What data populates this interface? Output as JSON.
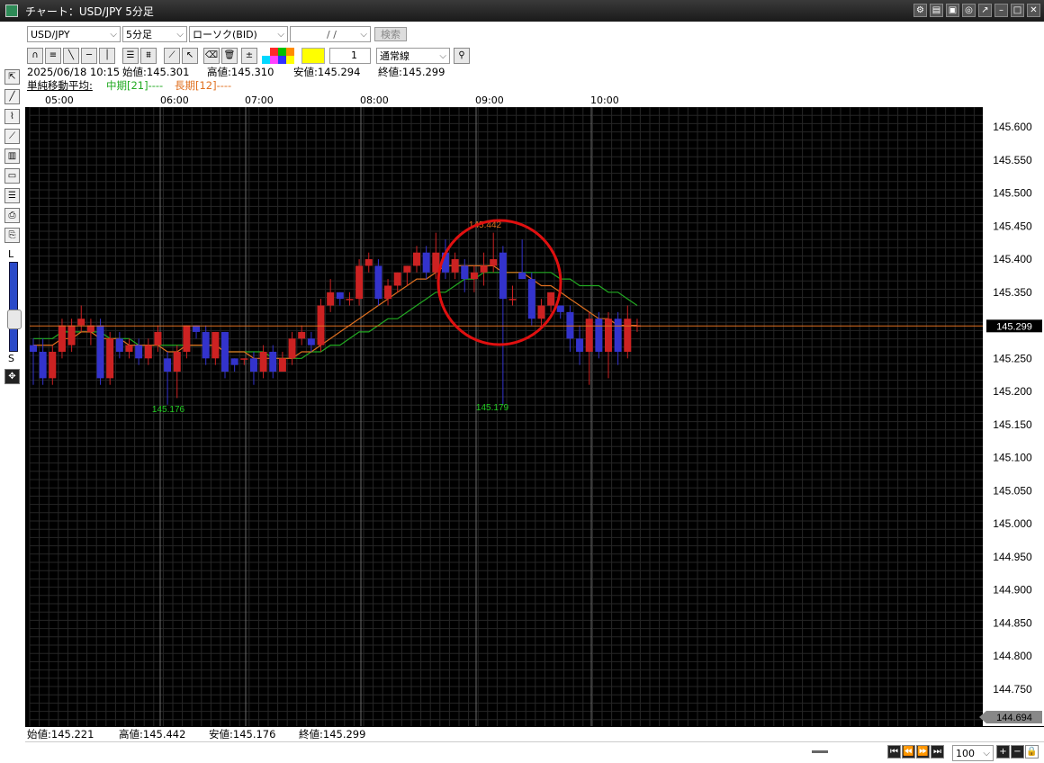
{
  "window": {
    "title": "チャート：USD/JPY 5分足"
  },
  "toolbar": {
    "symbol": "USD/JPY",
    "timeframe": "5分足",
    "chart_type": "ローソク(BID)",
    "date": "/ /",
    "search_label": "検索",
    "line_count": "1",
    "line_style": "通常線"
  },
  "ohlc_current": {
    "datetime": "2025/06/18 10:15",
    "open": "始値:145.301",
    "high": "高値:145.310",
    "low": "安値:145.294",
    "close": "終値:145.299"
  },
  "indicator": {
    "name": "単純移動平均:",
    "mid": "中期[21]----",
    "long": "長期[12]----"
  },
  "time_labels": [
    "05:00",
    "06:00",
    "07:00",
    "08:00",
    "09:00",
    "10:00"
  ],
  "price_labels": [
    "145.600",
    "145.550",
    "145.500",
    "145.450",
    "145.400",
    "145.350",
    "145.300",
    "145.250",
    "145.200",
    "145.150",
    "145.100",
    "145.050",
    "145.000",
    "144.950",
    "144.900",
    "144.850",
    "144.800",
    "144.750"
  ],
  "current_price": "145.299",
  "bottom_price": "144.694",
  "annotations": {
    "high_label": "145.442",
    "low_label_1": "145.176",
    "low_label_2": "145.179"
  },
  "summary": {
    "open": "始値:145.221",
    "high": "高値:145.442",
    "low": "安値:145.176",
    "close": "終値:145.299"
  },
  "status": {
    "zoom": "100"
  },
  "sidebar": {
    "l_label": "L",
    "s_label": "S"
  },
  "colors": {
    "bull": "#cc2222",
    "bear": "#3333cc",
    "ma_mid": "#22aa22",
    "ma_long": "#e07020",
    "circle": "#e01010"
  },
  "chart_data": {
    "type": "candlestick",
    "ylim": [
      144.694,
      145.63
    ],
    "candles": [
      [
        145.27,
        145.26,
        145.28,
        145.21
      ],
      [
        145.26,
        145.22,
        145.28,
        145.21
      ],
      [
        145.22,
        145.26,
        145.27,
        145.21
      ],
      [
        145.26,
        145.3,
        145.31,
        145.25
      ],
      [
        145.27,
        145.3,
        145.31,
        145.26
      ],
      [
        145.3,
        145.31,
        145.33,
        145.29
      ],
      [
        145.29,
        145.3,
        145.31,
        145.27
      ],
      [
        145.3,
        145.22,
        145.31,
        145.21
      ],
      [
        145.22,
        145.28,
        145.29,
        145.21
      ],
      [
        145.28,
        145.26,
        145.29,
        145.25
      ],
      [
        145.26,
        145.27,
        145.28,
        145.25
      ],
      [
        145.27,
        145.25,
        145.28,
        145.24
      ],
      [
        145.25,
        145.27,
        145.28,
        145.24
      ],
      [
        145.27,
        145.29,
        145.3,
        145.26
      ],
      [
        145.25,
        145.23,
        145.26,
        145.18
      ],
      [
        145.23,
        145.26,
        145.27,
        145.19
      ],
      [
        145.26,
        145.3,
        145.3,
        145.25
      ],
      [
        145.3,
        145.29,
        145.3,
        145.28
      ],
      [
        145.29,
        145.25,
        145.3,
        145.24
      ],
      [
        145.25,
        145.29,
        145.29,
        145.24
      ],
      [
        145.29,
        145.23,
        145.29,
        145.22
      ],
      [
        145.25,
        145.24,
        145.25,
        145.23
      ],
      [
        145.25,
        145.25,
        145.25,
        145.24
      ],
      [
        145.25,
        145.23,
        145.26,
        145.21
      ],
      [
        145.23,
        145.26,
        145.27,
        145.22
      ],
      [
        145.26,
        145.23,
        145.27,
        145.22
      ],
      [
        145.23,
        145.25,
        145.26,
        145.23
      ],
      [
        145.25,
        145.28,
        145.29,
        145.24
      ],
      [
        145.28,
        145.29,
        145.3,
        145.27
      ],
      [
        145.28,
        145.27,
        145.29,
        145.26
      ],
      [
        145.27,
        145.33,
        145.34,
        145.26
      ],
      [
        145.33,
        145.35,
        145.37,
        145.32
      ],
      [
        145.35,
        145.34,
        145.35,
        145.33
      ],
      [
        145.34,
        145.34,
        145.35,
        145.33
      ],
      [
        145.34,
        145.39,
        145.4,
        145.33
      ],
      [
        145.39,
        145.4,
        145.41,
        145.38
      ],
      [
        145.39,
        145.34,
        145.4,
        145.33
      ],
      [
        145.34,
        145.36,
        145.37,
        145.33
      ],
      [
        145.36,
        145.38,
        145.38,
        145.35
      ],
      [
        145.38,
        145.39,
        145.39,
        145.36
      ],
      [
        145.39,
        145.41,
        145.42,
        145.38
      ],
      [
        145.41,
        145.38,
        145.42,
        145.37
      ],
      [
        145.38,
        145.41,
        145.44,
        145.37
      ],
      [
        145.41,
        145.38,
        145.43,
        145.37
      ],
      [
        145.38,
        145.4,
        145.41,
        145.37
      ],
      [
        145.39,
        145.37,
        145.4,
        145.35
      ],
      [
        145.37,
        145.38,
        145.39,
        145.35
      ],
      [
        145.38,
        145.39,
        145.41,
        145.36
      ],
      [
        145.39,
        145.4,
        145.44,
        145.38
      ],
      [
        145.41,
        145.34,
        145.42,
        145.18
      ],
      [
        145.34,
        145.34,
        145.36,
        145.33
      ],
      [
        145.38,
        145.37,
        145.43,
        145.37
      ],
      [
        145.37,
        145.31,
        145.38,
        145.3
      ],
      [
        145.31,
        145.33,
        145.34,
        145.3
      ],
      [
        145.33,
        145.35,
        145.35,
        145.32
      ],
      [
        145.33,
        145.32,
        145.33,
        145.31
      ],
      [
        145.32,
        145.28,
        145.33,
        145.26
      ],
      [
        145.28,
        145.26,
        145.3,
        145.24
      ],
      [
        145.26,
        145.31,
        145.32,
        145.21
      ],
      [
        145.31,
        145.26,
        145.32,
        145.25
      ],
      [
        145.26,
        145.31,
        145.32,
        145.22
      ],
      [
        145.31,
        145.26,
        145.32,
        145.24
      ],
      [
        145.26,
        145.31,
        145.33,
        145.25
      ],
      [
        145.3,
        145.3,
        145.31,
        145.29
      ]
    ],
    "ma_mid": [
      145.28,
      145.28,
      145.28,
      145.29,
      145.29,
      145.29,
      145.29,
      145.29,
      145.28,
      145.28,
      145.28,
      145.27,
      145.27,
      145.27,
      145.27,
      145.27,
      145.27,
      145.27,
      145.27,
      145.27,
      145.26,
      145.26,
      145.26,
      145.26,
      145.26,
      145.25,
      145.25,
      145.25,
      145.25,
      145.26,
      145.26,
      145.27,
      145.27,
      145.28,
      145.29,
      145.29,
      145.3,
      145.31,
      145.31,
      145.32,
      145.33,
      145.34,
      145.35,
      145.35,
      145.36,
      145.37,
      145.37,
      145.38,
      145.38,
      145.38,
      145.38,
      145.38,
      145.38,
      145.38,
      145.38,
      145.37,
      145.37,
      145.36,
      145.36,
      145.36,
      145.35,
      145.35,
      145.34,
      145.33
    ],
    "ma_long": [
      145.27,
      145.27,
      145.27,
      145.28,
      145.28,
      145.29,
      145.29,
      145.28,
      145.28,
      145.28,
      145.27,
      145.27,
      145.27,
      145.27,
      145.26,
      145.26,
      145.27,
      145.27,
      145.27,
      145.27,
      145.26,
      145.26,
      145.26,
      145.25,
      145.25,
      145.25,
      145.25,
      145.25,
      145.26,
      145.26,
      145.27,
      145.28,
      145.29,
      145.3,
      145.31,
      145.32,
      145.33,
      145.34,
      145.35,
      145.36,
      145.37,
      145.37,
      145.38,
      145.39,
      145.39,
      145.39,
      145.39,
      145.39,
      145.39,
      145.38,
      145.38,
      145.38,
      145.37,
      145.36,
      145.36,
      145.35,
      145.34,
      145.33,
      145.32,
      145.31,
      145.31,
      145.3,
      145.3,
      145.3
    ]
  }
}
